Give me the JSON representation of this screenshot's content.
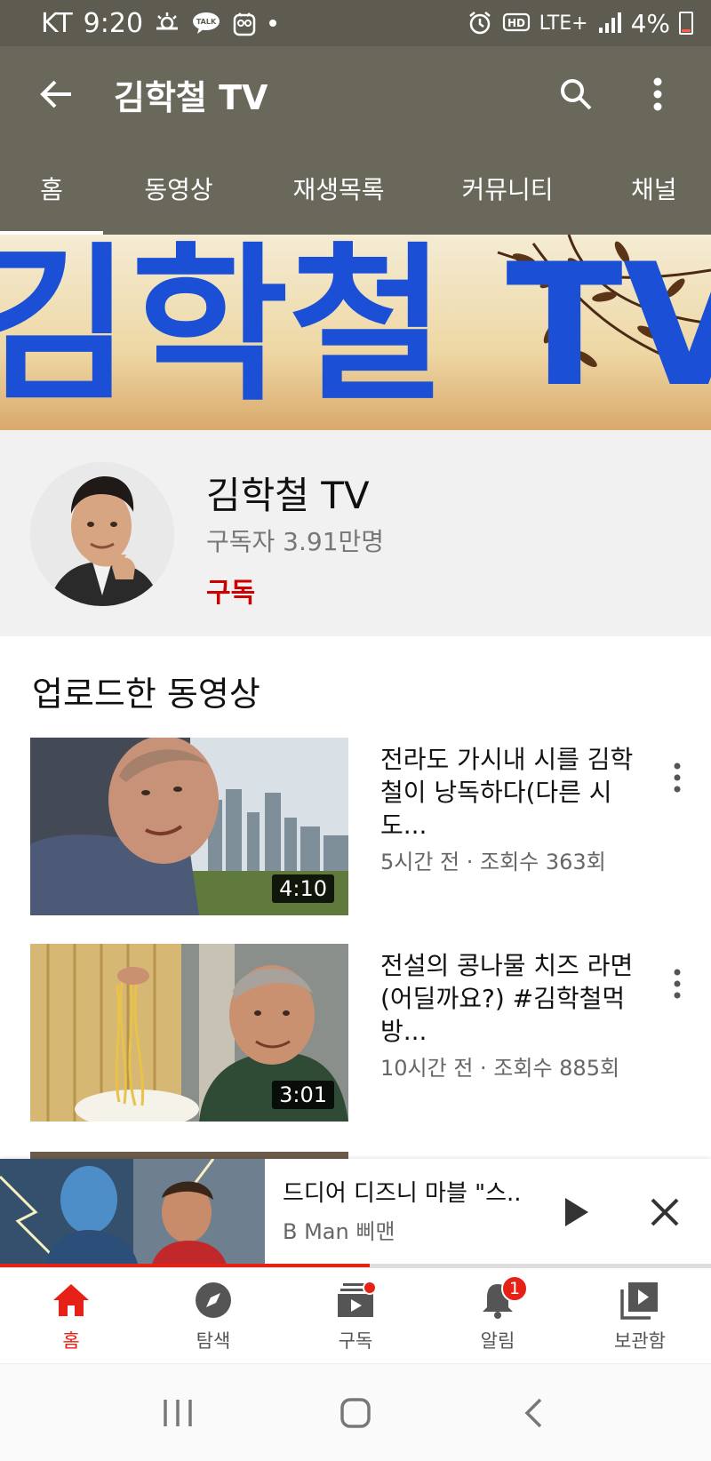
{
  "status_bar": {
    "carrier": "KT",
    "time": "9:20",
    "talk_label": "TALK",
    "network": "LTE+",
    "hd": "HD",
    "battery": "4%"
  },
  "app_bar": {
    "title": "김학철 TV",
    "back_icon": "arrow-left-icon",
    "search_icon": "search-icon",
    "more_icon": "more-vert-icon"
  },
  "tabs": [
    {
      "label": "홈",
      "active": true
    },
    {
      "label": "동영상",
      "active": false
    },
    {
      "label": "재생목록",
      "active": false
    },
    {
      "label": "커뮤니티",
      "active": false
    },
    {
      "label": "채널",
      "active": false
    }
  ],
  "banner": {
    "text": "김학철 TV"
  },
  "channel": {
    "name": "김학철 TV",
    "subscribers": "구독자 3.91만명",
    "subscribe_label": "구독"
  },
  "section": {
    "title": "업로드한 동영상"
  },
  "videos": [
    {
      "title": "전라도 가시내 시를 김학철이 낭독하다(다른 시도...",
      "meta": "5시간 전 · 조회수 363회",
      "duration": "4:10"
    },
    {
      "title": "전설의 콩나물 치즈 라면(어딜까요?) #김학철먹방...",
      "meta": "10시간 전 · 조회수 885회",
      "duration": "3:01"
    }
  ],
  "mini_player": {
    "title": "드디어 디즈니 마블 \"스..",
    "channel": "B Man 삐맨",
    "progress": 0.52
  },
  "bottom_nav": [
    {
      "label": "홈",
      "icon": "home-icon",
      "active": true
    },
    {
      "label": "탐색",
      "icon": "explore-icon",
      "active": false
    },
    {
      "label": "구독",
      "icon": "subscriptions-icon",
      "active": false
    },
    {
      "label": "알림",
      "icon": "bell-icon",
      "active": false,
      "badge": "1"
    },
    {
      "label": "보관함",
      "icon": "library-icon",
      "active": false
    }
  ],
  "colors": {
    "app_bar": "#6a685b",
    "accent_red": "#e62117",
    "subscribe_red": "#cc0000",
    "banner_text": "#1a4fd6"
  }
}
